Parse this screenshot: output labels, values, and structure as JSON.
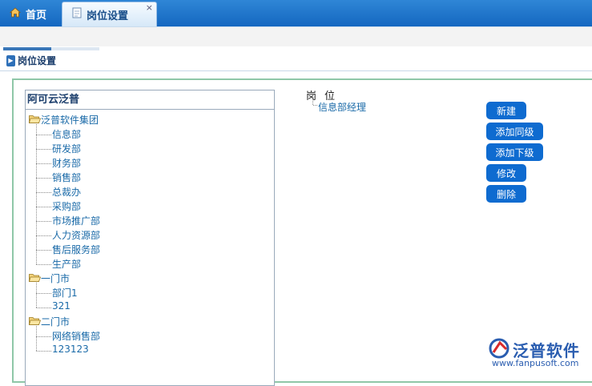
{
  "tabs": {
    "home_label": "首页",
    "active_label": "岗位设置",
    "close_glyph": "×"
  },
  "loading_progress": 0.5,
  "page_title": "岗位设置",
  "tree": {
    "root": "阿可云泛普",
    "groups": [
      {
        "label": "泛普软件集团",
        "children": [
          "信息部",
          "研发部",
          "财务部",
          "销售部",
          "总裁办",
          "采购部",
          "市场推广部",
          "人力资源部",
          "售后服务部",
          "生产部"
        ]
      },
      {
        "label": "一门市",
        "children": [
          "部门1",
          "321"
        ]
      },
      {
        "label": "二门市",
        "children": [
          "网络销售部",
          "123123"
        ]
      }
    ]
  },
  "positions": {
    "header": "岗位",
    "items": [
      "信息部经理"
    ]
  },
  "actions": {
    "new": "新建",
    "add_sibling": "添加同级",
    "add_child": "添加下级",
    "edit": "修改",
    "delete": "删除"
  },
  "watermark": {
    "brand": "泛普软件",
    "url": "www.fanpusoft.com"
  },
  "colors": {
    "topbar": "#1467c0",
    "button": "#0e6bd0",
    "link": "#1a6aa8",
    "frame_border": "#8fc7a8"
  }
}
